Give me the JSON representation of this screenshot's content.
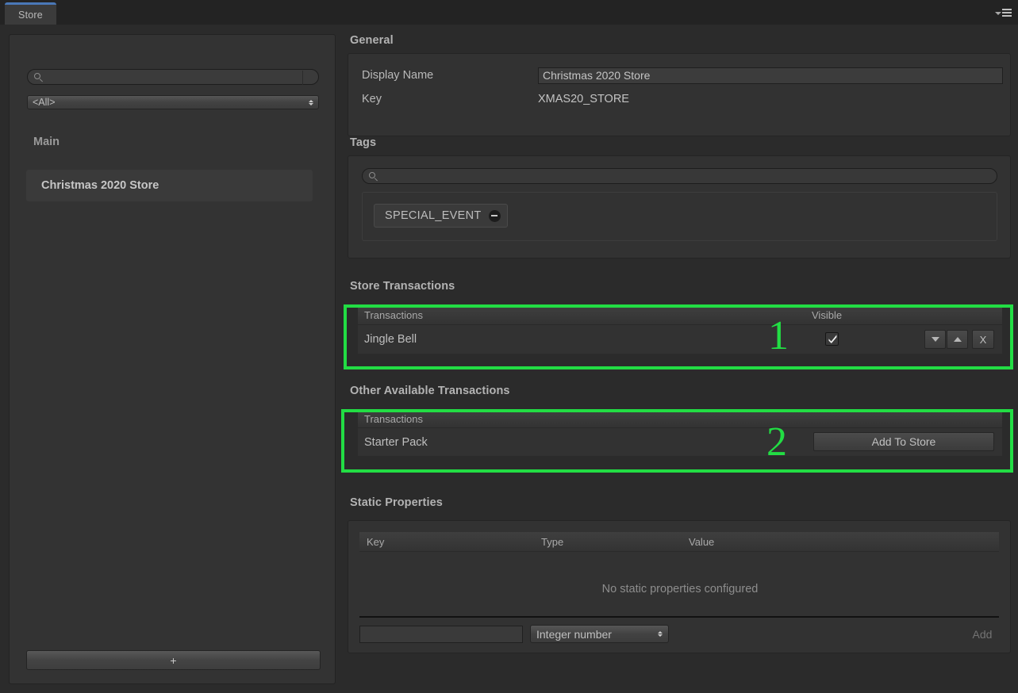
{
  "window": {
    "tab_label": "Store",
    "menu_icon": "hamburger-menu-icon",
    "dropdown_icon": "chevron-down-icon"
  },
  "sidebar": {
    "search_placeholder": "",
    "search_value": "",
    "search_icon": "search-icon",
    "filter_selected": "<All>",
    "group_title": "Main",
    "items": [
      {
        "label": "Christmas 2020 Store",
        "selected": true
      }
    ],
    "add_button_label": "+"
  },
  "general": {
    "section_title": "General",
    "display_name_label": "Display Name",
    "display_name_value": "Christmas 2020 Store",
    "key_label": "Key",
    "key_value": "XMAS20_STORE"
  },
  "tags": {
    "section_title": "Tags",
    "search_icon": "search-icon",
    "search_value": "",
    "chips": [
      {
        "label": "SPECIAL_EVENT",
        "remove_icon": "minus-circle-icon"
      }
    ]
  },
  "store_transactions": {
    "section_title": "Store Transactions",
    "columns": [
      "Transactions",
      "Visible"
    ],
    "rows": [
      {
        "name": "Jingle Bell",
        "visible": true,
        "move_down_label": "▼",
        "move_up_label": "▲",
        "remove_label": "X"
      }
    ]
  },
  "other_transactions": {
    "section_title": "Other Available Transactions",
    "columns": [
      "Transactions"
    ],
    "rows": [
      {
        "name": "Starter Pack",
        "action_label": "Add To Store"
      }
    ]
  },
  "static_properties": {
    "section_title": "Static Properties",
    "columns": [
      "Key",
      "Type",
      "Value"
    ],
    "empty_message": "No static properties configured",
    "new_key_value": "",
    "new_type_selected": "Integer number",
    "add_button_label": "Add"
  },
  "annotations": [
    {
      "number": "1",
      "target": "store-transactions-table"
    },
    {
      "number": "2",
      "target": "other-available-transactions-table"
    }
  ],
  "colors": {
    "annotation_green": "#22dd44",
    "tab_accent": "#4a78b8",
    "panel_bg": "#2b2b2b",
    "box_bg": "#323232"
  }
}
